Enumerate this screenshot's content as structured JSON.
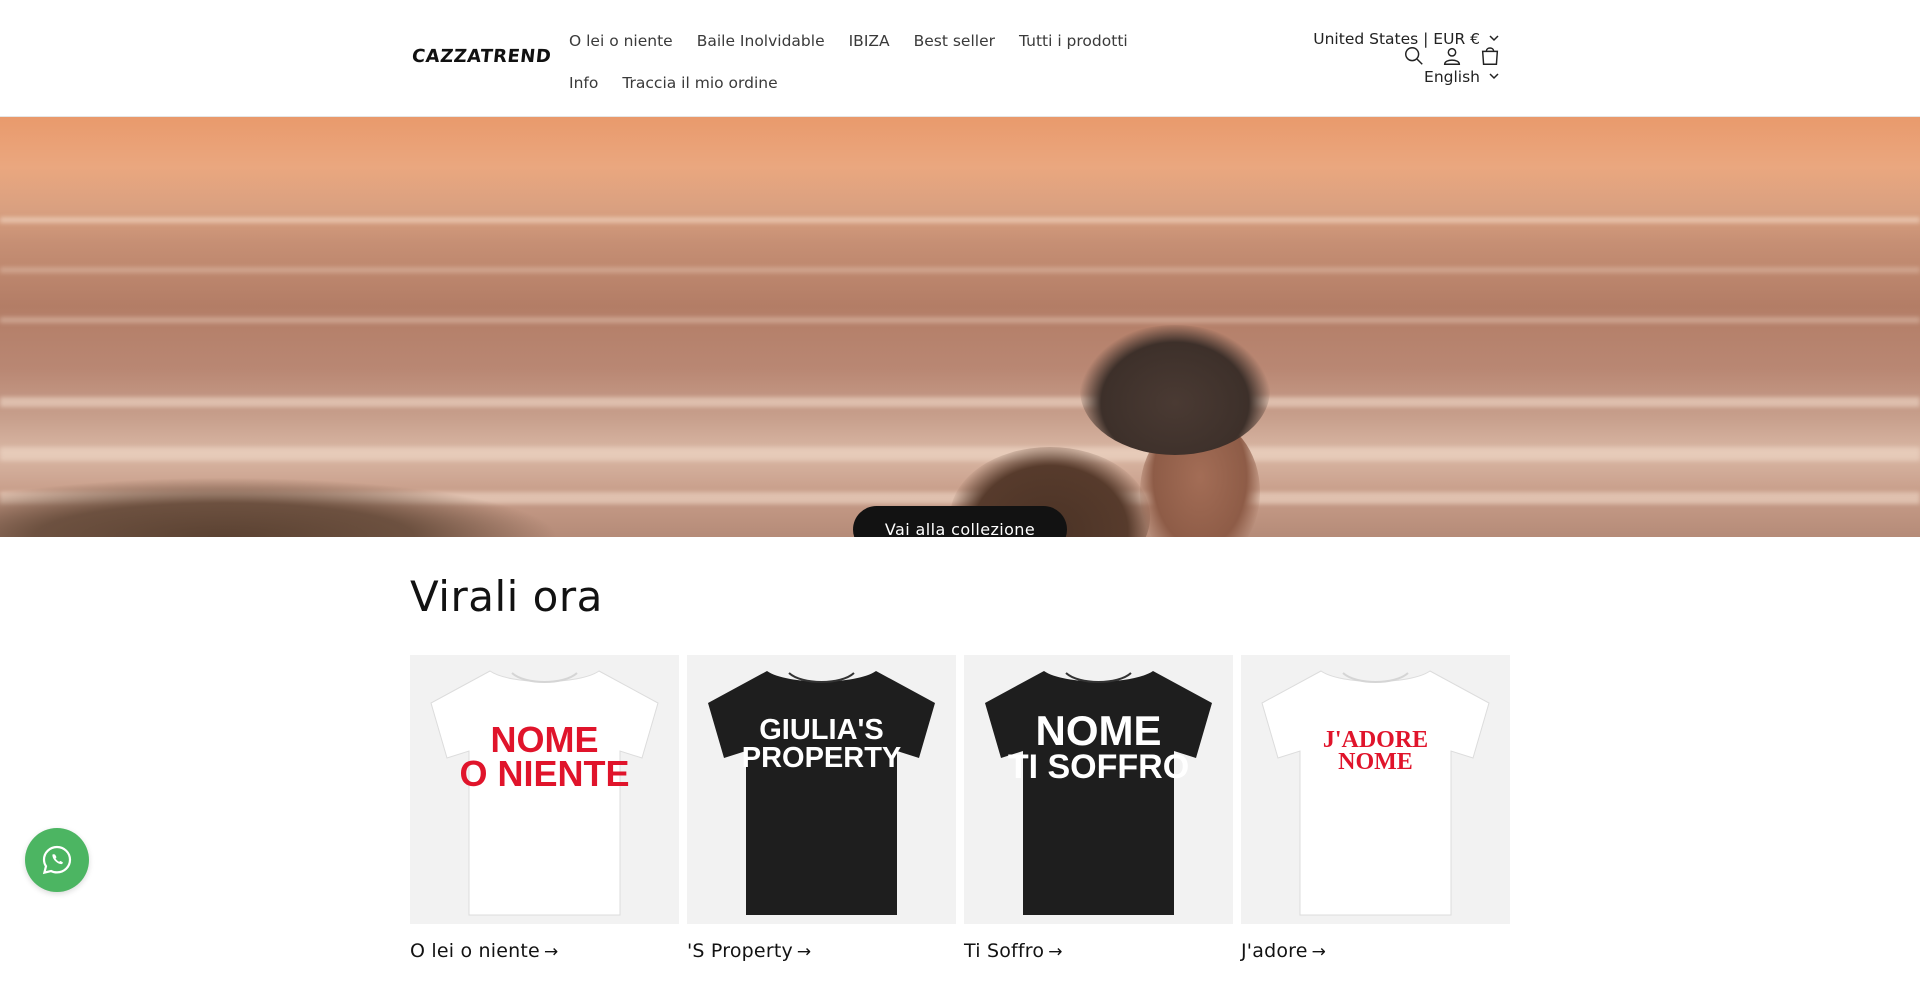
{
  "header": {
    "logo_text": "CAZZATREND",
    "nav_row1": [
      "O lei o niente",
      "Baile Inolvidable",
      "IBIZA",
      "Best seller",
      "Tutti i prodotti"
    ],
    "nav_row2": [
      "Info",
      "Traccia il mio ordine"
    ],
    "country_selector": "United States | EUR €",
    "language_selector": "English",
    "icons": [
      "search-icon",
      "account-icon",
      "cart-icon"
    ]
  },
  "hero": {
    "button_label": "Vai alla collezione"
  },
  "section": {
    "title": "Virali ora",
    "cards": [
      {
        "title": "O lei o niente",
        "shirt_color": "#ffffff",
        "print_lines": [
          "NOME",
          "O NIENTE"
        ],
        "print_color": "#e0142b"
      },
      {
        "title": "'S Property",
        "shirt_color": "#1e1e1e",
        "print_lines": [
          "GIULIA'S",
          "PROPERTY"
        ],
        "print_color": "#ffffff"
      },
      {
        "title": "Ti Soffro",
        "shirt_color": "#1e1e1e",
        "print_lines": [
          "NOME",
          "TI SOFFRO"
        ],
        "print_color": "#ffffff"
      },
      {
        "title": "J'adore",
        "shirt_color": "#ffffff",
        "print_lines": [
          "J'ADORE",
          "NOME"
        ],
        "print_color": "#e0142b"
      }
    ]
  },
  "colors": {
    "primary_button": "#121212",
    "whatsapp": "#4cb562"
  }
}
